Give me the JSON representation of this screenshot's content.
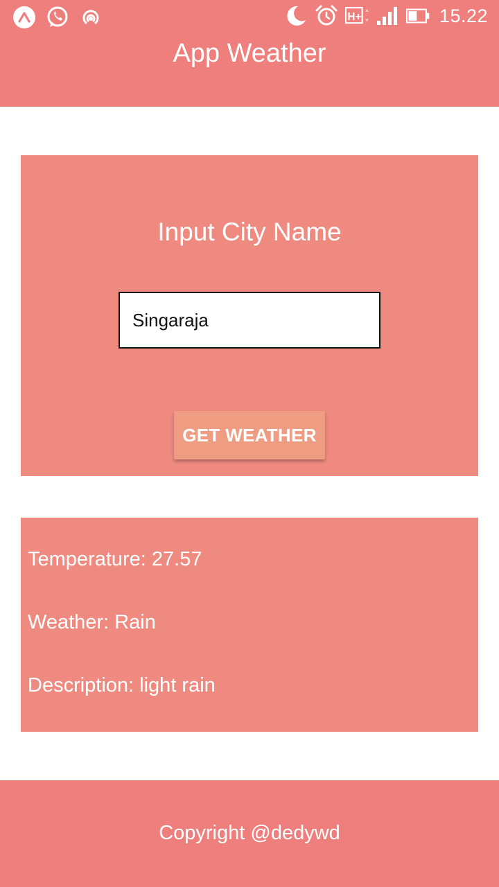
{
  "status_bar": {
    "left_icons": [
      "arrow-up-circle-icon",
      "whatsapp-icon",
      "hotspot-icon"
    ],
    "right_icons": [
      "moon-icon",
      "alarm-icon",
      "network-hplus-icon",
      "signal-icon",
      "battery-icon"
    ],
    "network_label": "H+",
    "time": "15.22"
  },
  "header": {
    "title": "App Weather"
  },
  "input_card": {
    "title": "Input City Name",
    "city_value": "Singaraja",
    "button_label": "GET WEATHER"
  },
  "result": {
    "temperature": "Temperature: 27.57",
    "weather": "Weather: Rain",
    "description": "Description: light rain"
  },
  "footer": {
    "text": "Copyright @dedywd"
  },
  "colors": {
    "header": "#ef7f7d",
    "card": "#ef8a80",
    "button": "#ef9d82",
    "text_light": "#ffffff"
  }
}
